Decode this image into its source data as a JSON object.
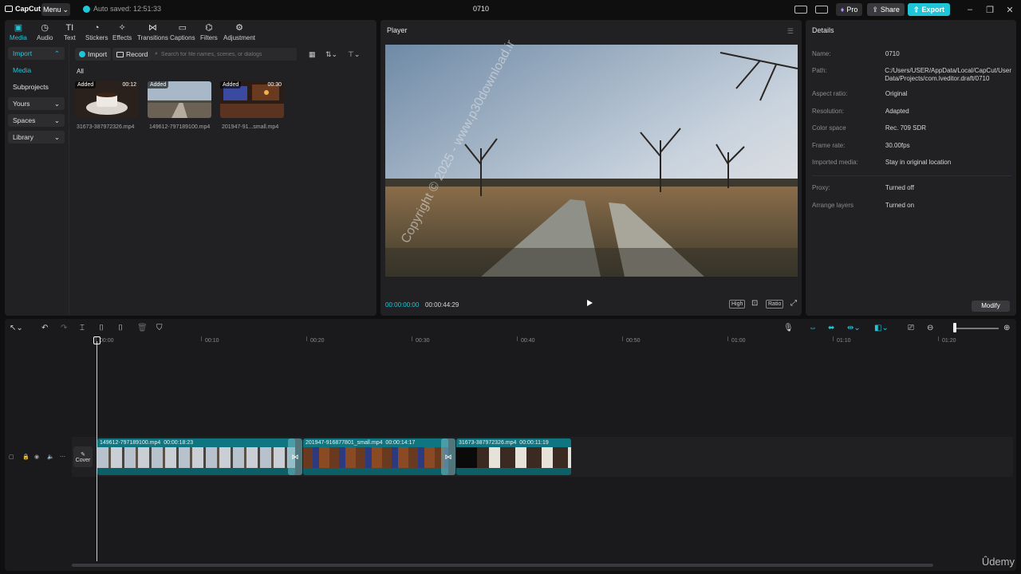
{
  "app": {
    "logo_text": "CapCut",
    "menu_label": "Menu",
    "autosave_text": "Auto saved: 12:51:33",
    "project_title": "0710",
    "pro_label": "Pro",
    "share_label": "Share",
    "export_label": "Export",
    "accent_color": "#1fc6d8"
  },
  "toolbar": {
    "tabs": [
      {
        "label": "Media",
        "icon": "media-icon"
      },
      {
        "label": "Audio",
        "icon": "audio-icon"
      },
      {
        "label": "Text",
        "icon": "text-icon"
      },
      {
        "label": "Stickers",
        "icon": "stickers-icon"
      },
      {
        "label": "Effects",
        "icon": "effects-icon"
      },
      {
        "label": "Transitions",
        "icon": "transitions-icon"
      },
      {
        "label": "Captions",
        "icon": "captions-icon"
      },
      {
        "label": "Filters",
        "icon": "filters-icon"
      },
      {
        "label": "Adjustment",
        "icon": "adjustment-icon"
      }
    ]
  },
  "sidebar": {
    "items": [
      {
        "label": "Import"
      },
      {
        "label": "Media"
      },
      {
        "label": "Subprojects"
      },
      {
        "label": "Yours"
      },
      {
        "label": "Spaces"
      },
      {
        "label": "Library"
      }
    ]
  },
  "media": {
    "import_label": "Import",
    "record_label": "Record",
    "search_placeholder": "Search for file names, scenes, or dialogs",
    "filter_label": "All",
    "items": [
      {
        "badge": "Added",
        "duration": "00:12",
        "name": "31673-387972326.mp4"
      },
      {
        "badge": "Added",
        "duration": "",
        "name": "149612-797189100.mp4"
      },
      {
        "badge": "Added",
        "duration": "00:30",
        "name": "201947-91...small.mp4"
      }
    ]
  },
  "player": {
    "title": "Player",
    "current_time": "00:00:00:00",
    "total_time": "00:00:44:29",
    "quality_label": "High",
    "ratio_label": "Ratio"
  },
  "details": {
    "title": "Details",
    "rows": [
      {
        "key": "Name:",
        "value": "0710"
      },
      {
        "key": "Path:",
        "value": "C:/Users/USER/AppData/Local/CapCut/User Data/Projects/com.lveditor.draft/0710"
      },
      {
        "key": "Aspect ratio:",
        "value": "Original"
      },
      {
        "key": "Resolution:",
        "value": "Adapted"
      },
      {
        "key": "Color space",
        "value": "Rec. 709 SDR"
      },
      {
        "key": "Frame rate:",
        "value": "30.00fps"
      },
      {
        "key": "Imported media:",
        "value": "Stay in original location"
      },
      {
        "key": "Proxy:",
        "value": "Turned off"
      },
      {
        "key": "Arrange layers",
        "value": "Turned on"
      }
    ],
    "modify_label": "Modify"
  },
  "timeline": {
    "ruler": [
      "00:00",
      "00:10",
      "00:20",
      "00:30",
      "00:40",
      "00:50",
      "01:00",
      "01:10",
      "01:20"
    ],
    "cover_label": "Cover",
    "clips": [
      {
        "name": "149612-797189100.mp4",
        "duration": "00:00:18:23"
      },
      {
        "name": "201947-916877801_small.mp4",
        "duration": "00:00:14:17"
      },
      {
        "name": "31673-387972326.mp4",
        "duration": "00:00:11:19"
      }
    ]
  },
  "overlay": {
    "watermark": "Copyright © 2025 - www.p30download.ir",
    "udemy": "Ûdemy"
  }
}
